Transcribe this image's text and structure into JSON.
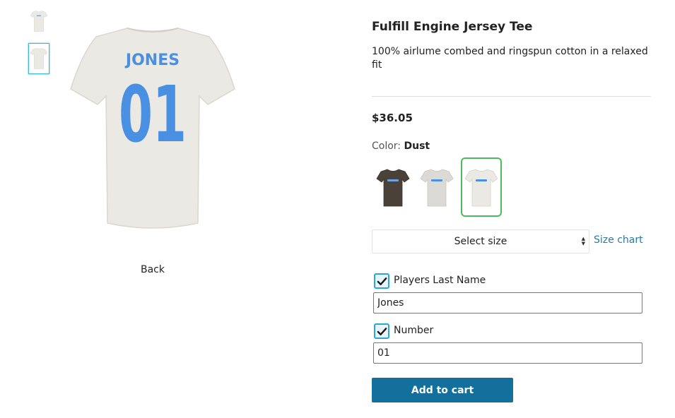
{
  "gallery": {
    "thumbnails": [
      {
        "icon": "tshirt-front-thumbnail",
        "selected": false
      },
      {
        "icon": "tshirt-back-thumbnail",
        "selected": true
      }
    ],
    "main_image": {
      "icon": "tshirt-back-image",
      "shirt_color": "#ebe9e3",
      "print_color": "#4a90e2",
      "print_name": "JONES",
      "print_number": "01"
    },
    "view_label": "Back"
  },
  "product": {
    "title": "Fulfill Engine Jersey Tee",
    "description": "100% airlume combed and ringspun cotton in a relaxed fit",
    "price": "$36.05",
    "color_label": "Color:",
    "color_value": "Dust"
  },
  "swatches": [
    {
      "icon": "tshirt-swatch-brown",
      "color": "#4a4139",
      "selected": false
    },
    {
      "icon": "tshirt-swatch-heather",
      "color": "#dcdad6",
      "selected": false
    },
    {
      "icon": "tshirt-swatch-dust",
      "color": "#ebe9e3",
      "selected": true
    }
  ],
  "size": {
    "selected_label": "Select size",
    "size_chart_link": "Size chart"
  },
  "personalization": {
    "last_name": {
      "label": "Players Last Name",
      "checked": true,
      "value": "Jones"
    },
    "number": {
      "label": "Number",
      "checked": true,
      "value": "01"
    }
  },
  "cart": {
    "button_label": "Add to cart",
    "button_color": "#136f9b"
  }
}
